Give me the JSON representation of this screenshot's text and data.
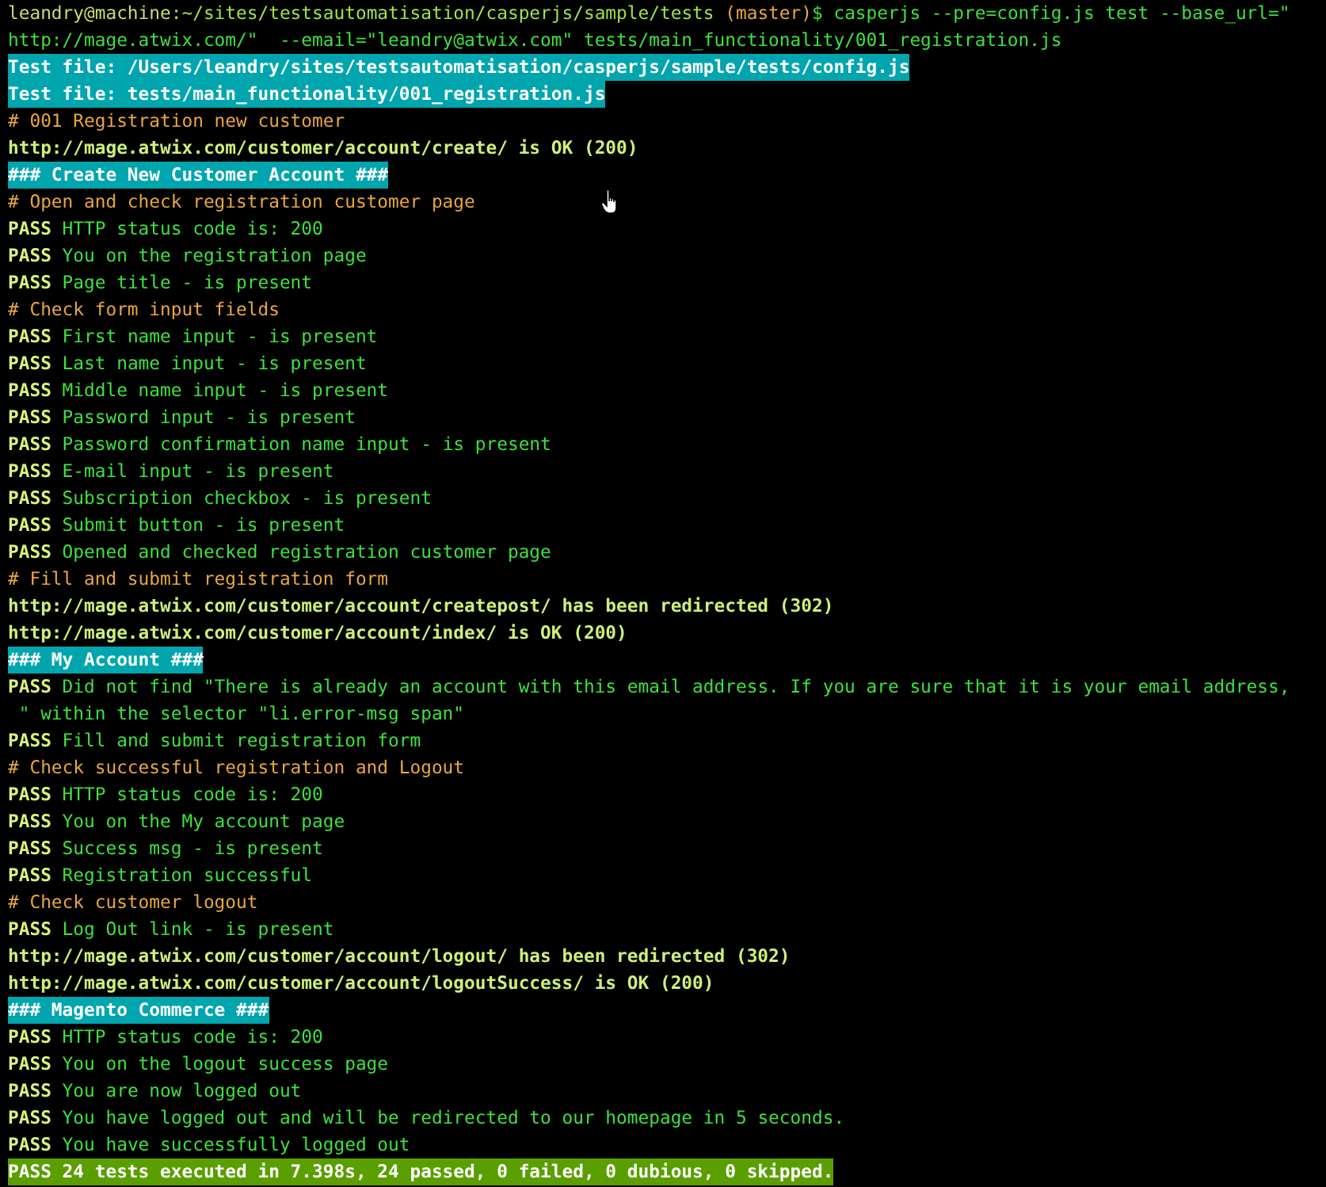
{
  "terminal": {
    "prompt": {
      "user": "leandry@machine",
      "path": ":~/sites/testsautomatisation/casperjs/sample/tests",
      "branch": "(master)",
      "command": "$ casperjs --pre=config.js test --base_url=\""
    },
    "lines": [
      {
        "kind": "command",
        "text": "http://mage.atwix.com/\"  --email=\"leandry@atwix.com\" tests/main_functionality/001_registration.js"
      },
      {
        "kind": "info",
        "text": "Test file: /Users/leandry/sites/testsautomatisation/casperjs/sample/tests/config.js"
      },
      {
        "kind": "info",
        "text": "Test file: tests/main_functionality/001_registration.js"
      },
      {
        "kind": "comment",
        "text": "# 001 Registration new customer"
      },
      {
        "kind": "url",
        "text": "http://mage.atwix.com/customer/account/create/ is OK (200)"
      },
      {
        "kind": "info",
        "text": "### Create New Customer Account ###"
      },
      {
        "kind": "comment",
        "text": "# Open and check registration customer page"
      },
      {
        "kind": "pass",
        "label": "PASS",
        "text": "HTTP status code is: 200"
      },
      {
        "kind": "pass",
        "label": "PASS",
        "text": "You on the registration page"
      },
      {
        "kind": "pass",
        "label": "PASS",
        "text": "Page title - is present"
      },
      {
        "kind": "comment",
        "text": "# Check form input fields"
      },
      {
        "kind": "pass",
        "label": "PASS",
        "text": "First name input - is present"
      },
      {
        "kind": "pass",
        "label": "PASS",
        "text": "Last name input - is present"
      },
      {
        "kind": "pass",
        "label": "PASS",
        "text": "Middle name input - is present"
      },
      {
        "kind": "pass",
        "label": "PASS",
        "text": "Password input - is present"
      },
      {
        "kind": "pass",
        "label": "PASS",
        "text": "Password confirmation name input - is present"
      },
      {
        "kind": "pass",
        "label": "PASS",
        "text": "E-mail input - is present"
      },
      {
        "kind": "pass",
        "label": "PASS",
        "text": "Subscription checkbox - is present"
      },
      {
        "kind": "pass",
        "label": "PASS",
        "text": "Submit button - is present"
      },
      {
        "kind": "pass",
        "label": "PASS",
        "text": "Opened and checked registration customer page"
      },
      {
        "kind": "comment",
        "text": "# Fill and submit registration form"
      },
      {
        "kind": "url",
        "text": "http://mage.atwix.com/customer/account/createpost/ has been redirected (302)"
      },
      {
        "kind": "url",
        "text": "http://mage.atwix.com/customer/account/index/ is OK (200)"
      },
      {
        "kind": "info",
        "text": "### My Account ###"
      },
      {
        "kind": "pass",
        "label": "PASS",
        "text": "Did not find \"There is already an account with this email address. If you are sure that it is your email address,"
      },
      {
        "kind": "plain",
        "text": " \" within the selector \"li.error-msg span\""
      },
      {
        "kind": "pass",
        "label": "PASS",
        "text": "Fill and submit registration form"
      },
      {
        "kind": "comment",
        "text": "# Check successful registration and Logout"
      },
      {
        "kind": "pass",
        "label": "PASS",
        "text": "HTTP status code is: 200"
      },
      {
        "kind": "pass",
        "label": "PASS",
        "text": "You on the My account page"
      },
      {
        "kind": "pass",
        "label": "PASS",
        "text": "Success msg - is present"
      },
      {
        "kind": "pass",
        "label": "PASS",
        "text": "Registration successful"
      },
      {
        "kind": "comment",
        "text": "# Check customer logout"
      },
      {
        "kind": "pass",
        "label": "PASS",
        "text": "Log Out link - is present"
      },
      {
        "kind": "url",
        "text": "http://mage.atwix.com/customer/account/logout/ has been redirected (302)"
      },
      {
        "kind": "url",
        "text": "http://mage.atwix.com/customer/account/logoutSuccess/ is OK (200)"
      },
      {
        "kind": "info",
        "text": "### Magento Commerce ###"
      },
      {
        "kind": "pass",
        "label": "PASS",
        "text": "HTTP status code is: 200"
      },
      {
        "kind": "pass",
        "label": "PASS",
        "text": "You on the logout success page"
      },
      {
        "kind": "pass",
        "label": "PASS",
        "text": "You are now logged out"
      },
      {
        "kind": "pass",
        "label": "PASS",
        "text": "You have logged out and will be redirected to our homepage in 5 seconds."
      },
      {
        "kind": "pass",
        "label": "PASS",
        "text": "You have successfully logged out"
      },
      {
        "kind": "summary",
        "text": "PASS 24 tests executed in 7.398s, 24 passed, 0 failed, 0 dubious, 0 skipped."
      }
    ]
  }
}
